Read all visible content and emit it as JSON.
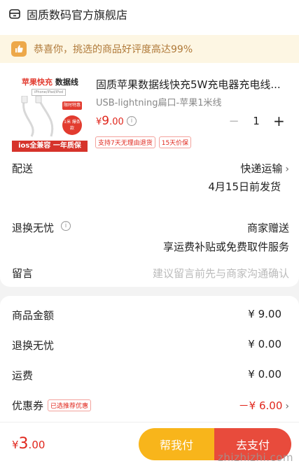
{
  "store": {
    "name": "固质数码官方旗舰店"
  },
  "banner": {
    "text": "恭喜你，挑选的商品好评度高达99%"
  },
  "product": {
    "thumb_title_red": "苹果快充",
    "thumb_title_black": "数据线",
    "thumb_subtitle": "iPhone/iPad/iPod",
    "thumb_promo": "限时特惠",
    "thumb_badge": "1米 爆条款",
    "thumb_strip": "ios全兼容 一年质保",
    "title": "固质苹果数据线快充5W充电器充电线...",
    "variant": "USB-lightning扁口-苹果1米线",
    "price_symbol": "¥",
    "price_main": "9",
    "price_decimal": ".00",
    "quantity": "1",
    "tags": [
      "支持7天无理由退货",
      "15天价保"
    ]
  },
  "delivery": {
    "label": "配送",
    "method": "快递运输",
    "ship_date": "4月15日前发货"
  },
  "returns": {
    "label": "退换无忧",
    "provider": "商家赠送",
    "detail": "享运费补贴或免费取件服务"
  },
  "message": {
    "label": "留言",
    "placeholder": "建议留言前先与商家沟通确认"
  },
  "summary": {
    "items": [
      {
        "label": "商品金额",
        "value": "¥ 9.00"
      },
      {
        "label": "退换无忧",
        "value": "¥ 0.00"
      },
      {
        "label": "运费",
        "value": "¥ 0.00"
      }
    ],
    "coupon_label": "优惠券",
    "coupon_tag": "已选推荐优惠",
    "coupon_value": "－¥ 6.00"
  },
  "footer": {
    "total_symbol": "¥",
    "total_main": "3",
    "total_decimal": ".00",
    "help_pay_label": "帮我付",
    "pay_label": "去支付",
    "watermark": "zhizhizhi.com"
  },
  "colors": {
    "accent": "#e0261c",
    "help_button": "#f8b51b",
    "pay_button": "#e84b3c",
    "banner_bg": "#fdf6e3"
  }
}
